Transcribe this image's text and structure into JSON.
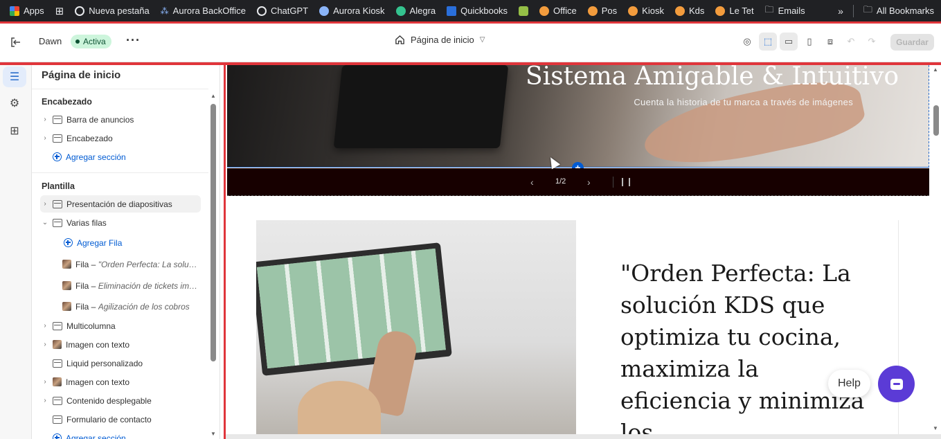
{
  "bookmarks": {
    "items": [
      {
        "label": "Apps",
        "icon": "apps-grid-icon",
        "color": "#ea4335"
      },
      {
        "label": "",
        "icon": "grid-icon",
        "color": "#e8eaed"
      },
      {
        "label": "Nueva pestaña",
        "icon": "globe-icon",
        "color": "#e8eaed"
      },
      {
        "label": "Aurora BackOffice",
        "icon": "aurora-icon",
        "color": "#8ab4f8"
      },
      {
        "label": "ChatGPT",
        "icon": "chatgpt-icon",
        "color": "#e8eaed"
      },
      {
        "label": "Aurora Kiosk",
        "icon": "aurora-kiosk-icon",
        "color": "#8ab4f8"
      },
      {
        "label": "Alegra",
        "icon": "alegra-icon",
        "color": "#34c38f"
      },
      {
        "label": "Quickbooks",
        "icon": "quickbooks-icon",
        "color": "#2a6fdb"
      },
      {
        "label": "",
        "icon": "shopify-icon",
        "color": "#95bf47"
      },
      {
        "label": "Office",
        "icon": "office-icon",
        "color": "#f39c3d"
      },
      {
        "label": "Pos",
        "icon": "pos-icon",
        "color": "#f39c3d"
      },
      {
        "label": "Kiosk",
        "icon": "kiosk-icon",
        "color": "#f39c3d"
      },
      {
        "label": "Kds",
        "icon": "kds-icon",
        "color": "#f39c3d"
      },
      {
        "label": "Le Tet",
        "icon": "letet-icon",
        "color": "#f39c3d"
      },
      {
        "label": "Emails",
        "icon": "folder-icon",
        "color": "#e8eaed"
      }
    ],
    "all_bookmarks": "All Bookmarks"
  },
  "topbar": {
    "theme": "Dawn",
    "status": "Activa",
    "page": "Página de inicio",
    "save": "Guardar"
  },
  "sidebar": {
    "title": "Página de inicio",
    "header_heading": "Encabezado",
    "header_items": [
      {
        "label": "Barra de anuncios"
      },
      {
        "label": "Encabezado"
      }
    ],
    "add_section": "Agregar sección",
    "template_heading": "Plantilla",
    "slideshow": "Presentación de diapositivas",
    "multirow": "Varias filas",
    "add_row": "Agregar Fila",
    "rows": [
      {
        "prefix": "Fila – ",
        "title": "\"Orden Perfecta: La solución KDS que optimiza tu cocina..."
      },
      {
        "prefix": "Fila – ",
        "title": "Eliminación de tickets impresos..."
      },
      {
        "prefix": "Fila – ",
        "title": "Agilización de los cobros"
      }
    ],
    "sections": [
      {
        "label": "Multicolumna"
      },
      {
        "label": "Imagen con texto"
      },
      {
        "label": "Liquid personalizado"
      },
      {
        "label": "Imagen con texto"
      },
      {
        "label": "Contenido desplegable"
      },
      {
        "label": "Formulario de contacto"
      }
    ],
    "add_section_bottom": "Agregar sección"
  },
  "preview": {
    "hero_title": "Sistema Amigable & Intuitivo",
    "hero_subtitle": "Cuenta la historia de tu marca a través de imágenes",
    "slide_counter": "1/2",
    "row_heading": "\"Orden Perfecta: La solución KDS que optimiza tu cocina, maximiza la eficiencia y minimiza los",
    "help": "Help"
  }
}
